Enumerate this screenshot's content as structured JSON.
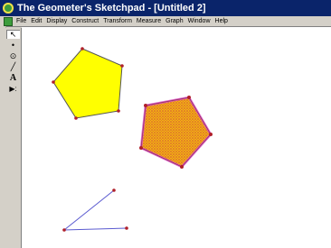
{
  "window": {
    "title": "The Geometer's Sketchpad - [Untitled 2]"
  },
  "menu": {
    "items": [
      "File",
      "Edit",
      "Display",
      "Construct",
      "Transform",
      "Measure",
      "Graph",
      "Window",
      "Help"
    ]
  },
  "toolbox": {
    "tools": [
      {
        "name": "arrow-tool-icon",
        "glyph": "↖"
      },
      {
        "name": "point-tool-icon",
        "glyph": "•"
      },
      {
        "name": "compass-tool-icon",
        "glyph": "⊙"
      },
      {
        "name": "straightedge-tool-icon",
        "glyph": "╱"
      },
      {
        "name": "text-tool-icon",
        "glyph": "A"
      },
      {
        "name": "custom-tool-icon",
        "glyph": "▶:"
      }
    ]
  },
  "colors": {
    "yellow_fill": "#ffff00",
    "hatched_fill": "#f5a623",
    "selection_outline": "#d94fc2",
    "point": "#b0202a",
    "segment": "#5a5ad0"
  }
}
